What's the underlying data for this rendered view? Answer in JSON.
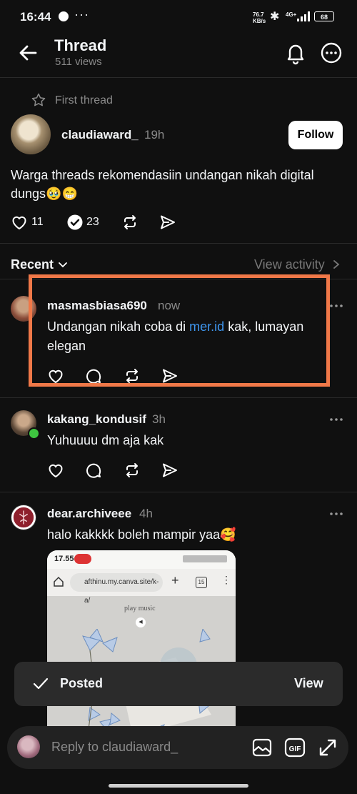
{
  "status_bar": {
    "time": "16:44",
    "more": "···",
    "net_speed": "76.7",
    "net_unit": "KB/s",
    "network": "4G+",
    "battery": "68"
  },
  "header": {
    "title": "Thread",
    "views": "511 views"
  },
  "original_post": {
    "first_thread_label": "First thread",
    "username": "claudiaward_",
    "time": "19h",
    "follow_label": "Follow",
    "text": "Warga threads rekomendasiin undangan nikah digital dungs🥹😁",
    "likes": "11",
    "replies": "23"
  },
  "sort": {
    "label": "Recent",
    "view_activity": "View activity"
  },
  "replies": [
    {
      "username": "masmasbiasa690",
      "time": "now",
      "text_before": "Undangan nikah coba di ",
      "link": "mer.id",
      "text_after": " kak, lumayan elegan"
    },
    {
      "username": "kakang_kondusif",
      "time": "3h",
      "text": "Yuhuuuu dm aja kak"
    },
    {
      "username": "dear.archiveee",
      "time": "4h",
      "text": "halo kakkkk boleh mampir yaa🥰"
    }
  ],
  "embedded_screenshot": {
    "time": "17.55",
    "url": "afthinu.my.canva.site/k-a/",
    "tabs": "15",
    "play_music": "play music"
  },
  "toast": {
    "label": "Posted",
    "action": "View"
  },
  "reply_bar": {
    "placeholder": "Reply to claudiaward_"
  },
  "colors": {
    "background": "#101010",
    "link": "#3f97f0",
    "highlight": "#f07848",
    "online": "#3ec540"
  }
}
